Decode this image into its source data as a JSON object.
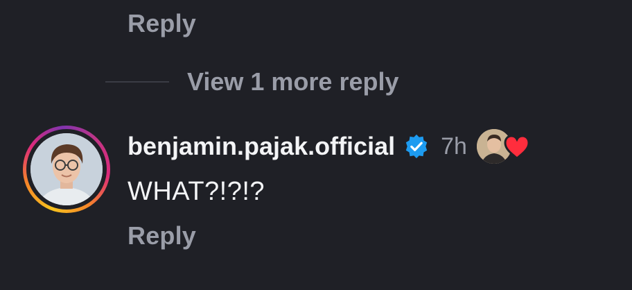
{
  "thread": {
    "reply_label_top": "Reply",
    "view_more_label": "View 1 more reply"
  },
  "comment": {
    "username": "benjamin.pajak.official",
    "verified": true,
    "timestamp": "7h",
    "text": "WHAT?!?!?",
    "reply_label": "Reply",
    "liked_by_author": true
  },
  "colors": {
    "background": "#1f2026",
    "primary_text": "#f3f4f6",
    "secondary_text": "#9a9da8",
    "verified_badge": "#1d9bf0",
    "heart": "#ff2d3d"
  },
  "icons": {
    "verified": "verified-badge-icon",
    "heart": "heart-icon"
  }
}
